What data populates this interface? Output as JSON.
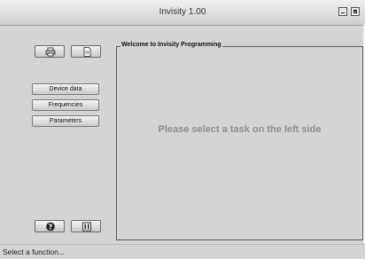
{
  "window": {
    "title": "Invisity 1.00",
    "buttons": [
      "minimize-icon",
      "maximize-icon"
    ]
  },
  "toolbar": {
    "top_icons": [
      "printer-icon",
      "document-icon"
    ],
    "bottom_icons": [
      "help-icon",
      "info-icon"
    ]
  },
  "nav": {
    "items": [
      {
        "label": "Device data"
      },
      {
        "label": "Frequencies"
      },
      {
        "label": "Parameters"
      }
    ]
  },
  "main": {
    "group_title": "Welcome to Invisity Programming",
    "message": "Please select  a task on the left side"
  },
  "status": {
    "text": "Select a function..."
  },
  "colors": {
    "background": "#d4d4d4",
    "message": "#8e8e8e",
    "frame": "#5a5a5a"
  }
}
